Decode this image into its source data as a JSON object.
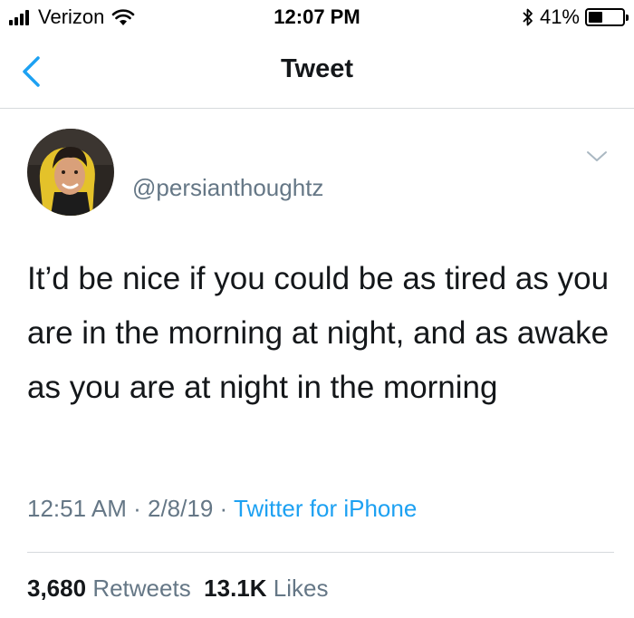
{
  "status_bar": {
    "carrier": "Verizon",
    "time": "12:07 PM",
    "battery_percent": "41%",
    "battery_level": 0.41,
    "icons": [
      "signal-icon",
      "wifi-icon",
      "bluetooth-icon",
      "battery-icon"
    ]
  },
  "nav": {
    "title": "Tweet",
    "back_icon": "chevron-left-icon"
  },
  "tweet": {
    "handle": "@persianthoughtz",
    "avatar_icon": "avatar",
    "menu_icon": "chevron-down-icon",
    "text": "It’d be nice if you could be as tired as you are in the morning at night, and as awake as you are at night in the morning",
    "time": "12:51 AM",
    "separator": "·",
    "date": "2/8/19",
    "source": "Twitter for iPhone",
    "source_color": "#1da1f2"
  },
  "stats": {
    "retweets_count": "3,680",
    "retweets_label": "Retweets",
    "likes_count": "13.1K",
    "likes_label": "Likes"
  }
}
